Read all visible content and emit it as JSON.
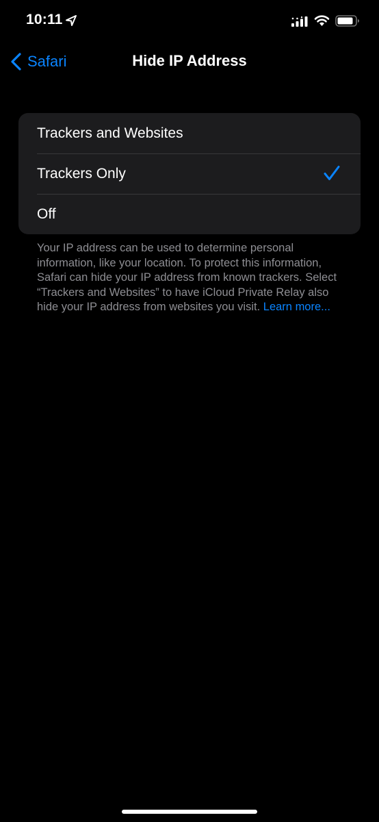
{
  "status_bar": {
    "time": "10:11",
    "location_icon": "location-arrow-icon",
    "signal_icon": "cellular-signal-icon",
    "wifi_icon": "wifi-icon",
    "battery_icon": "battery-icon"
  },
  "nav": {
    "back_label": "Safari",
    "title": "Hide IP Address"
  },
  "options": [
    {
      "label": "Trackers and Websites",
      "selected": false
    },
    {
      "label": "Trackers Only",
      "selected": true
    },
    {
      "label": "Off",
      "selected": false
    }
  ],
  "footer": {
    "description": "Your IP address can be used to determine personal information, like your location. To protect this information, Safari can hide your IP address from known trackers. Select “Trackers and Websites” to have iCloud Private Relay also hide your IP address from websites you visit.",
    "learn_more": "Learn more..."
  },
  "colors": {
    "background": "#000000",
    "group_background": "#1c1c1e",
    "accent": "#0a84ff",
    "secondary_text": "#8e8e93"
  }
}
